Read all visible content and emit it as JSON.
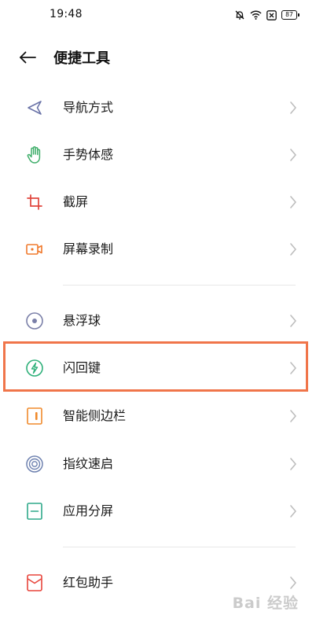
{
  "status_bar": {
    "time": "19:48",
    "battery": "87"
  },
  "header": {
    "title": "便捷工具"
  },
  "menu": {
    "items": [
      {
        "label": "导航方式",
        "icon": "navigation-arrow-icon",
        "color": "#6b74a8"
      },
      {
        "label": "手势体感",
        "icon": "hand-gesture-icon",
        "color": "#3fae6a"
      },
      {
        "label": "截屏",
        "icon": "crop-icon",
        "color": "#e0443c"
      },
      {
        "label": "屏幕录制",
        "icon": "video-record-icon",
        "color": "#f07a2d"
      },
      {
        "label": "悬浮球",
        "icon": "floating-ball-icon",
        "color": "#7a7fa8"
      },
      {
        "label": "闪回键",
        "icon": "flashback-bolt-icon",
        "color": "#2fb07a"
      },
      {
        "label": "智能侧边栏",
        "icon": "sidebar-icon",
        "color": "#f08a2c"
      },
      {
        "label": "指纹速启",
        "icon": "fingerprint-icon",
        "color": "#6f82b0"
      },
      {
        "label": "应用分屏",
        "icon": "split-screen-icon",
        "color": "#2fa98a"
      },
      {
        "label": "红包助手",
        "icon": "red-envelope-icon",
        "color": "#e8453c"
      }
    ]
  },
  "watermark": "Bai 经验"
}
